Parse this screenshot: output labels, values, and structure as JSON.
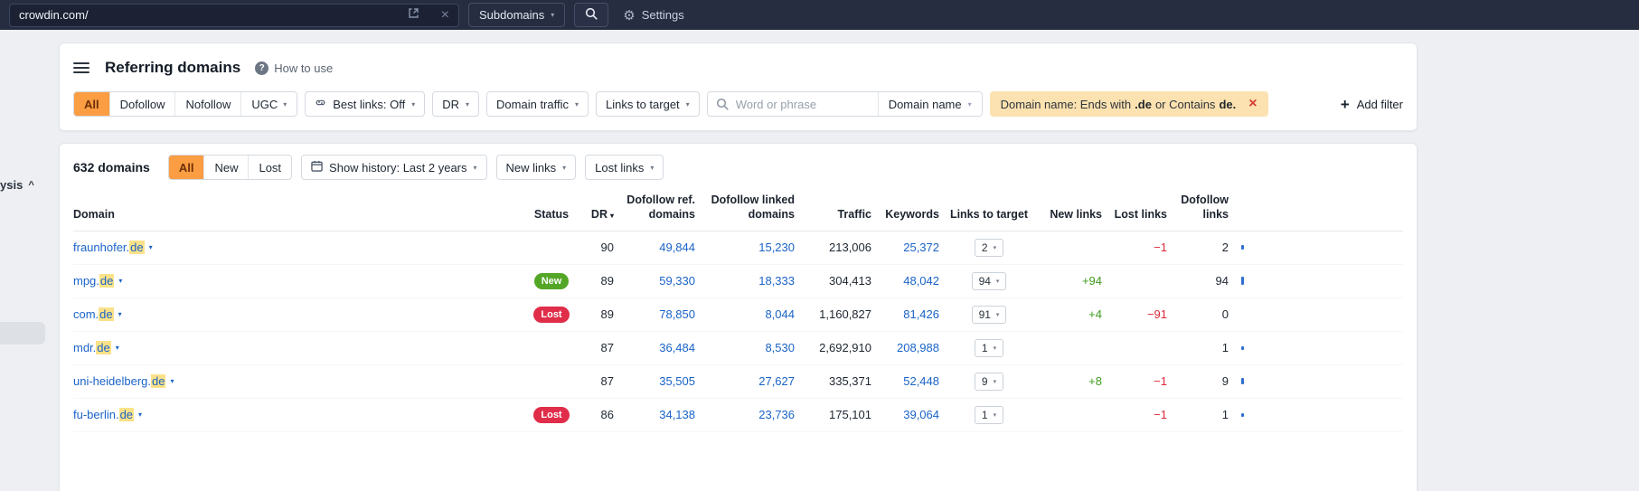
{
  "topbar": {
    "url_value": "crowdin.com/",
    "mode_label": "Subdomains",
    "settings_label": "Settings"
  },
  "sidebar_fragment": {
    "label": "ysis"
  },
  "header": {
    "title": "Referring domains",
    "help_label": "How to use"
  },
  "filters": {
    "segments": [
      "All",
      "Dofollow",
      "Nofollow",
      "UGC"
    ],
    "selected_segment": "All",
    "best_links": "Best links: Off",
    "dr": "DR",
    "domain_traffic": "Domain traffic",
    "links_to_target": "Links to target",
    "search_placeholder": "Word or phrase",
    "domain_name": "Domain name",
    "chip": {
      "prefix": "Domain name: Ends with",
      "bold1": ".de",
      "middle": "or Contains",
      "bold2": "de."
    },
    "add_filter": "Add filter"
  },
  "toolbar": {
    "count": "632 domains",
    "segments": [
      "All",
      "New",
      "Lost"
    ],
    "selected_segment": "All",
    "show_history": "Show history: Last 2 years",
    "new_links": "New links",
    "lost_links": "Lost links"
  },
  "table": {
    "columns": [
      "Domain",
      "Status",
      "DR",
      "Dofollow ref. domains",
      "Dofollow linked domains",
      "Traffic",
      "Keywords",
      "Links to target",
      "New links",
      "Lost links",
      "Dofollow links"
    ],
    "rows": [
      {
        "domain_name": "fraunhofer.",
        "domain_mark": "de",
        "status": "",
        "dr": "90",
        "dofollow_ref": "49,844",
        "dofollow_linked": "15,230",
        "traffic": "213,006",
        "keywords": "25,372",
        "links_to_target": "2",
        "new_links": "",
        "lost_links": "−1",
        "dofollow_links": "2",
        "spark": 5
      },
      {
        "domain_name": "mpg.",
        "domain_mark": "de",
        "status": "New",
        "dr": "89",
        "dofollow_ref": "59,330",
        "dofollow_linked": "18,333",
        "traffic": "304,413",
        "keywords": "48,042",
        "links_to_target": "94",
        "new_links": "+94",
        "lost_links": "",
        "dofollow_links": "94",
        "spark": 9
      },
      {
        "domain_name": "com.",
        "domain_mark": "de",
        "status": "Lost",
        "dr": "89",
        "dofollow_ref": "78,850",
        "dofollow_linked": "8,044",
        "traffic": "1,160,827",
        "keywords": "81,426",
        "links_to_target": "91",
        "new_links": "+4",
        "lost_links": "−91",
        "dofollow_links": "0",
        "spark": 0
      },
      {
        "domain_name": "mdr.",
        "domain_mark": "de",
        "status": "",
        "dr": "87",
        "dofollow_ref": "36,484",
        "dofollow_linked": "8,530",
        "traffic": "2,692,910",
        "keywords": "208,988",
        "links_to_target": "1",
        "new_links": "",
        "lost_links": "",
        "dofollow_links": "1",
        "spark": 4
      },
      {
        "domain_name": "uni-heidelberg.",
        "domain_mark": "de",
        "status": "",
        "dr": "87",
        "dofollow_ref": "35,505",
        "dofollow_linked": "27,627",
        "traffic": "335,371",
        "keywords": "52,448",
        "links_to_target": "9",
        "new_links": "+8",
        "lost_links": "−1",
        "dofollow_links": "9",
        "spark": 7
      },
      {
        "domain_name": "fu-berlin.",
        "domain_mark": "de",
        "status": "Lost",
        "dr": "86",
        "dofollow_ref": "34,138",
        "dofollow_linked": "23,736",
        "traffic": "175,101",
        "keywords": "39,064",
        "links_to_target": "1",
        "new_links": "",
        "lost_links": "−1",
        "dofollow_links": "1",
        "spark": 4
      }
    ]
  },
  "colors": {
    "accent_orange": "#fa9d43",
    "chip_bg": "#fbe2b0",
    "badge_new": "#53a626",
    "badge_lost": "#e02d49",
    "link_blue": "#1a63c8",
    "positive_green": "#3f9a1e",
    "negative_red": "#dc2b3c",
    "highlight_yellow": "#fbe289",
    "topbar_bg": "#262d40"
  }
}
